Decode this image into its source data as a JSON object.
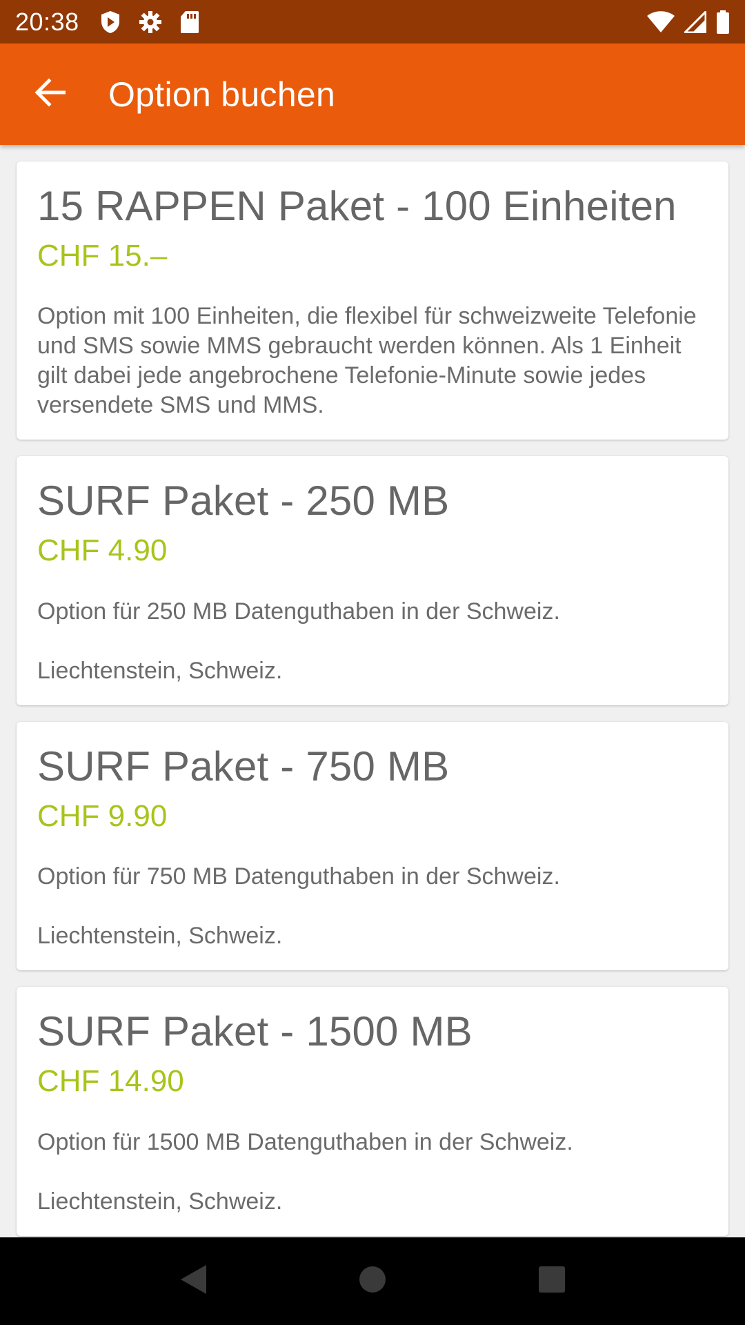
{
  "status_bar": {
    "time": "20:38",
    "left_icons": [
      "shield-play-icon",
      "gear-icon",
      "sd-card-icon"
    ],
    "right_icons": [
      "wifi-icon",
      "cell-signal-icon",
      "battery-icon"
    ]
  },
  "app_bar": {
    "back_icon": "arrow-back-icon",
    "title": "Option buchen",
    "color": "#ea5b0c"
  },
  "colors": {
    "status_bar": "#923804",
    "price": "#a8c41a",
    "title_text": "#666666"
  },
  "options": [
    {
      "title": "15 RAPPEN Paket - 100 Einheiten",
      "price": "CHF 15.–",
      "description": "Option mit 100 Einheiten, die flexibel für schweizweite Telefonie und SMS sowie MMS gebraucht werden können. Als 1 Einheit gilt dabei jede angebrochene Telefonie-Minute sowie jedes versendete SMS und MMS.",
      "region": ""
    },
    {
      "title": "SURF Paket - 250 MB",
      "price": "CHF 4.90",
      "description": "Option für 250 MB Datenguthaben in der Schweiz.",
      "region": "Liechtenstein, Schweiz."
    },
    {
      "title": "SURF Paket - 750 MB",
      "price": "CHF 9.90",
      "description": "Option für 750 MB Datenguthaben in der Schweiz.",
      "region": "Liechtenstein, Schweiz."
    },
    {
      "title": "SURF Paket - 1500 MB",
      "price": "CHF 14.90",
      "description": "Option für 1500 MB Datenguthaben in der Schweiz.",
      "region": "Liechtenstein, Schweiz."
    }
  ],
  "nav_bar": {
    "buttons": [
      "back-triangle-icon",
      "home-circle-icon",
      "recents-square-icon"
    ]
  }
}
